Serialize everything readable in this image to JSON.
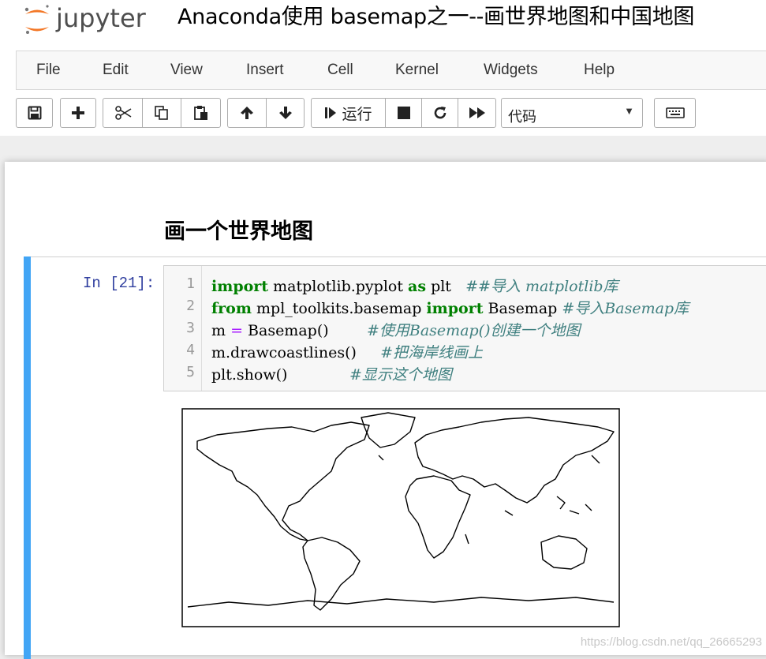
{
  "header": {
    "logo_text": "jupyter",
    "notebook_title": "Anaconda使用 basemap之一--画世界地图和中国地图"
  },
  "menu": [
    "File",
    "Edit",
    "View",
    "Insert",
    "Cell",
    "Kernel",
    "Widgets",
    "Help"
  ],
  "toolbar": {
    "run_label": "运行",
    "cell_type": "代码",
    "icons": [
      "save-icon",
      "plus-icon",
      "scissors-icon",
      "copy-icon",
      "paste-icon",
      "arrow-up-icon",
      "arrow-down-icon",
      "step-icon",
      "stop-icon",
      "restart-icon",
      "fast-forward-icon",
      "keyboard-icon"
    ]
  },
  "notebook": {
    "markdown_heading": "画一个世界地图",
    "cell": {
      "prompt": "In [21]:",
      "line_numbers": [
        "1",
        "2",
        "3",
        "4",
        "5"
      ],
      "lines": [
        {
          "t1": "import",
          "t2": " matplotlib.pyplot ",
          "t3": "as",
          "t4": " plt   ",
          "c": "##导入 matplotlib库"
        },
        {
          "t1": "from",
          "t2": " mpl_toolkits.basemap ",
          "t3": "import",
          "t4": " Basemap ",
          "c": "#导入Basemap库"
        },
        {
          "t1": "m ",
          "op": "=",
          "t2": " Basemap()        ",
          "c": "#使用Basemap()创建一个地图"
        },
        {
          "t1": "m.drawcoastlines()     ",
          "c": "#把海岸线画上"
        },
        {
          "t1": "plt.show()             ",
          "c": "#显示这个地图"
        }
      ]
    }
  },
  "watermark": "https://blog.csdn.net/qq_26665293",
  "colors": {
    "cell_selected_border": "#42a5f5",
    "prompt": "#303f9f",
    "keyword": "#008000",
    "comment": "#408080",
    "logo_orange": "#f37726"
  }
}
